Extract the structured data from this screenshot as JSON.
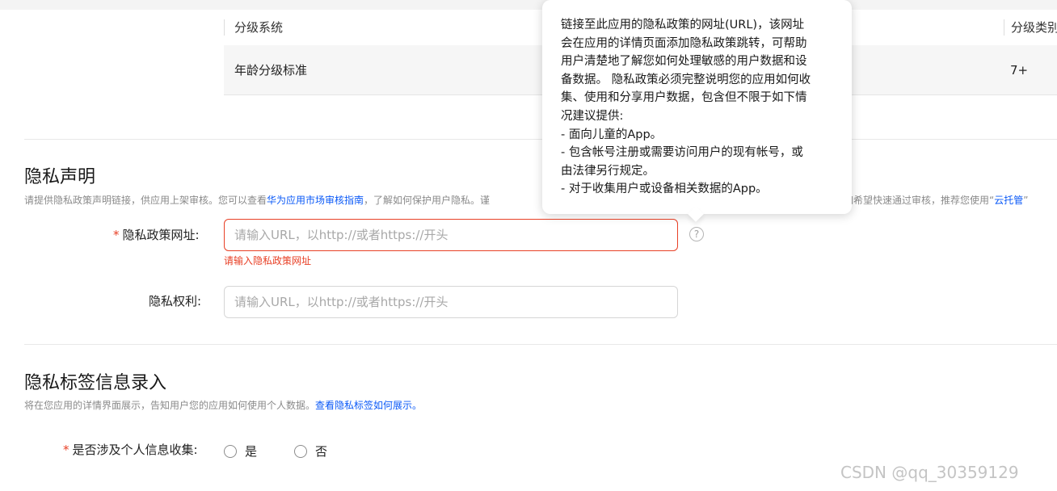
{
  "rating": {
    "header_system": "分级系统",
    "header_type": "分级类别",
    "row_label": "年龄分级标准",
    "row_value": "7+"
  },
  "privacy": {
    "title": "隐私声明",
    "desc_prefix": "请提供隐私政策声明链接，供应用上架审核。您可以查看",
    "desc_link": "华为应用市场审核指南",
    "desc_middle": "，了解如何保护用户隐私。谨",
    "desc_right_prefix": "如希望快速通过审核，推荐您使用“",
    "desc_right_link": "云托管",
    "desc_right_suffix": "”",
    "policy_url": {
      "required_mark": "*",
      "label": "隐私政策网址:",
      "placeholder": "请输入URL，以http://或者https://开头",
      "value": "",
      "error": "请输入隐私政策网址",
      "help_glyph": "?"
    },
    "rights_url": {
      "label": "隐私权利:",
      "placeholder": "请输入URL，以http://或者https://开头",
      "value": ""
    }
  },
  "tooltip": {
    "lines": [
      "链接至此应用的隐私政策的网址(URL)，该网址",
      "会在应用的详情页面添加隐私政策跳转，可帮助",
      "用户清楚地了解您如何处理敏感的用户数据和设",
      "备数据。 隐私政策必须完整说明您的应用如何收",
      "集、使用和分享用户数据，包含但不限于如下情",
      "况建议提供:",
      "- 面向儿童的App。",
      "- 包含帐号注册或需要访问用户的现有帐号，或",
      "由法律另行规定。",
      "- 对于收集用户或设备相关数据的App。"
    ]
  },
  "label_section": {
    "title": "隐私标签信息录入",
    "desc_prefix": "将在您应用的详情界面展示，告知用户您的应用如何使用个人数据。",
    "desc_link": "查看隐私标签如何展示。",
    "collect_question": {
      "required_mark": "*",
      "label": "是否涉及个人信息收集:",
      "options": [
        "是",
        "否"
      ]
    }
  },
  "watermark": "CSDN @qq_30359129"
}
